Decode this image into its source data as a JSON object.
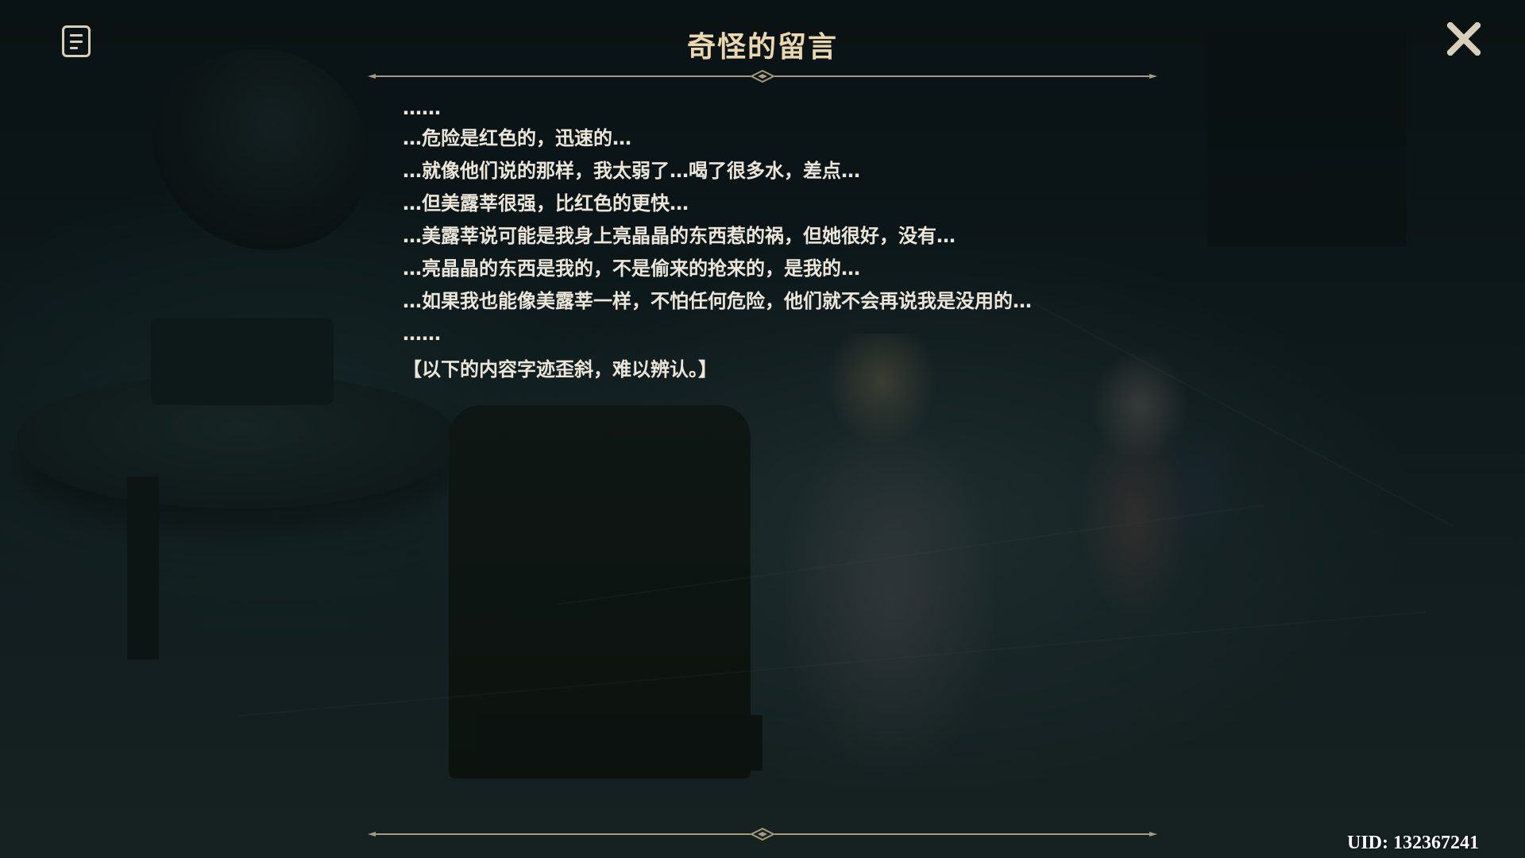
{
  "window": {
    "title": "奇怪的留言"
  },
  "header": {
    "menu_icon": "document-list-icon",
    "close_icon": "close-x-icon"
  },
  "note": {
    "lines": [
      "……",
      "…危险是红色的，迅速的…",
      "…就像他们说的那样，我太弱了…喝了很多水，差点…",
      "…但美露莘很强，比红色的更快…",
      "…美露莘说可能是我身上亮晶晶的东西惹的祸，但她很好，没有…",
      "…亮晶晶的东西是我的，不是偷来的抢来的，是我的…",
      "…如果我也能像美露莘一样，不怕任何危险，他们就不会再说我是没用的…",
      "……",
      "【以下的内容字迹歪斜，难以辨认。】"
    ]
  },
  "footer": {
    "uid": "UID: 132367241"
  },
  "colors": {
    "title": "#ead7ae",
    "body_text": "#ece6da",
    "divider": "#a89a7c",
    "icon": "#d8cfb8"
  }
}
